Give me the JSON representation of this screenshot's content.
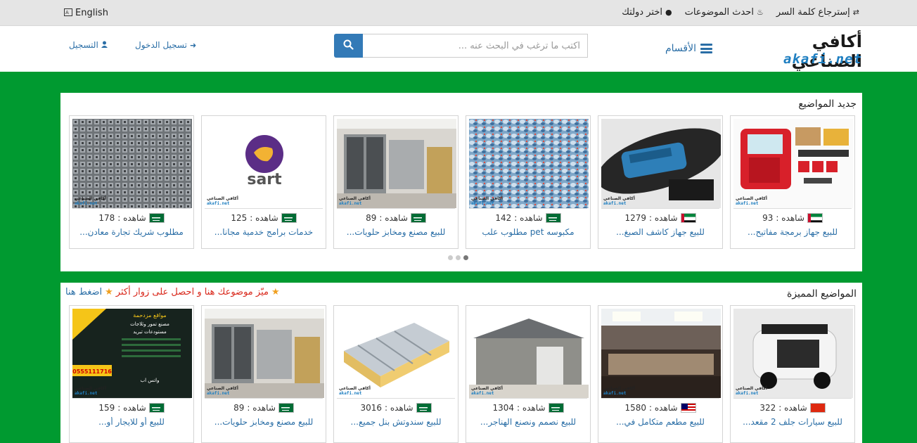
{
  "topbar": {
    "language": "English",
    "links": [
      "إسترجاع كلمة السر",
      "احدث الموضوعات",
      "اختر دولتك"
    ]
  },
  "header": {
    "logo_ar": "أكافي الصناعي",
    "logo_en": "akafi.net",
    "menu_label": "الأقسام",
    "search_placeholder": "اكتب ما ترغب في البحث عنه ...",
    "login": "تسجيل الدخول",
    "register": "التسجيل"
  },
  "latest": {
    "title": "جديد المواضيع",
    "items": [
      {
        "views": "93",
        "views_label": "شاهده :",
        "title": "للبيع جهاز برمجة مفاتيح...",
        "flag": "ae"
      },
      {
        "views": "1279",
        "views_label": "شاهده :",
        "title": "للبيع جهاز كاشف الصبغ...",
        "flag": "ae"
      },
      {
        "views": "142",
        "views_label": "شاهده :",
        "title": "مكبوسه pet مطلوب علب",
        "flag": "sa"
      },
      {
        "views": "89",
        "views_label": "شاهده :",
        "title": "للبيع مصنع ومخابز حلويات...",
        "flag": "sa"
      },
      {
        "views": "125",
        "views_label": "شاهده :",
        "title": "خدمات برامج خدمية مجانا...",
        "flag": "sa"
      },
      {
        "views": "178",
        "views_label": "شاهده :",
        "title": "مطلوب شريك تجارة معادن...",
        "flag": "sa"
      }
    ]
  },
  "featured": {
    "title": "المواضيع المميزة",
    "promo_text": "ميّز موضوعك هنا و احصل على زوار أكثر",
    "promo_link": "اضغط هنا",
    "items": [
      {
        "views": "322",
        "views_label": "شاهده :",
        "title": "للبيع سيارات جلف 2 مقعد...",
        "flag": "cn"
      },
      {
        "views": "1580",
        "views_label": "شاهده :",
        "title": "للبيع مطعم متكامل في...",
        "flag": "my"
      },
      {
        "views": "1304",
        "views_label": "شاهده :",
        "title": "للبيع نصمم ونصنع الهناجر...",
        "flag": "sa"
      },
      {
        "views": "3016",
        "views_label": "شاهده :",
        "title": "للبيع سندوتش بنل جميع...",
        "flag": "sa"
      },
      {
        "views": "89",
        "views_label": "شاهده :",
        "title": "للبيع مصنع ومخابز حلويات...",
        "flag": "sa"
      },
      {
        "views": "159",
        "views_label": "شاهده :",
        "title": "للبيع أو للايجار أو...",
        "flag": "sa"
      }
    ],
    "promo_card": {
      "phone": "0555111716",
      "heading": "مواقع مزدحمة",
      "line1": "مصنع تمور وثلاجات",
      "line2": "مستودعات تبريد",
      "footer": "واتس اب"
    }
  },
  "watermark": {
    "ar": "أكافي الصناعي",
    "en": "akafi.net"
  },
  "latest_image_labels": {
    "sart": "sart"
  },
  "colors": {
    "green": "#009a30",
    "link": "#2a6ea6",
    "search_btn": "#337ab7"
  }
}
